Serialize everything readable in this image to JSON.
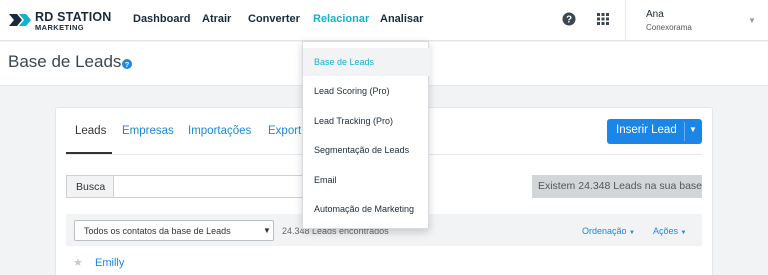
{
  "colors": {
    "accent": "#14b2cf",
    "primary_button": "#1a86e8",
    "link": "#1a86e8",
    "dark_text": "#1a2a3a"
  },
  "logo": {
    "line1": "RD STATION",
    "line2": "MARKETING"
  },
  "nav": {
    "items": [
      {
        "label": "Dashboard"
      },
      {
        "label": "Atrair"
      },
      {
        "label": "Converter"
      },
      {
        "label": "Relacionar",
        "active": true
      },
      {
        "label": "Analisar"
      }
    ],
    "icons": [
      "question-circle-icon",
      "apps-grid-icon"
    ],
    "user": {
      "name": "Ana",
      "company": "Conexorama"
    }
  },
  "page": {
    "title": "Base de Leads"
  },
  "tabs": [
    {
      "label": "Leads",
      "active": true
    },
    {
      "label": "Empresas"
    },
    {
      "label": "Importações"
    },
    {
      "label": "Export"
    }
  ],
  "insert_button": {
    "label": "Inserir Lead"
  },
  "search": {
    "label": "Busca",
    "value": "",
    "leads_total": "Existem 24.348 Leads na sua base"
  },
  "filter": {
    "selected": "Todos os contatos da base de Leads",
    "found": "24.348 Leads encontrados",
    "order_label": "Ordenação",
    "actions_label": "Ações"
  },
  "leads": [
    {
      "name": "Emilly"
    }
  ],
  "dropdown": {
    "items": [
      {
        "label": "Base de Leads",
        "active": true
      },
      {
        "label": "Lead Scoring (Pro)"
      },
      {
        "label": "Lead Tracking (Pro)"
      },
      {
        "label": "Segmentação de Leads"
      },
      {
        "label": "Email"
      },
      {
        "label": "Automação de Marketing"
      }
    ]
  }
}
